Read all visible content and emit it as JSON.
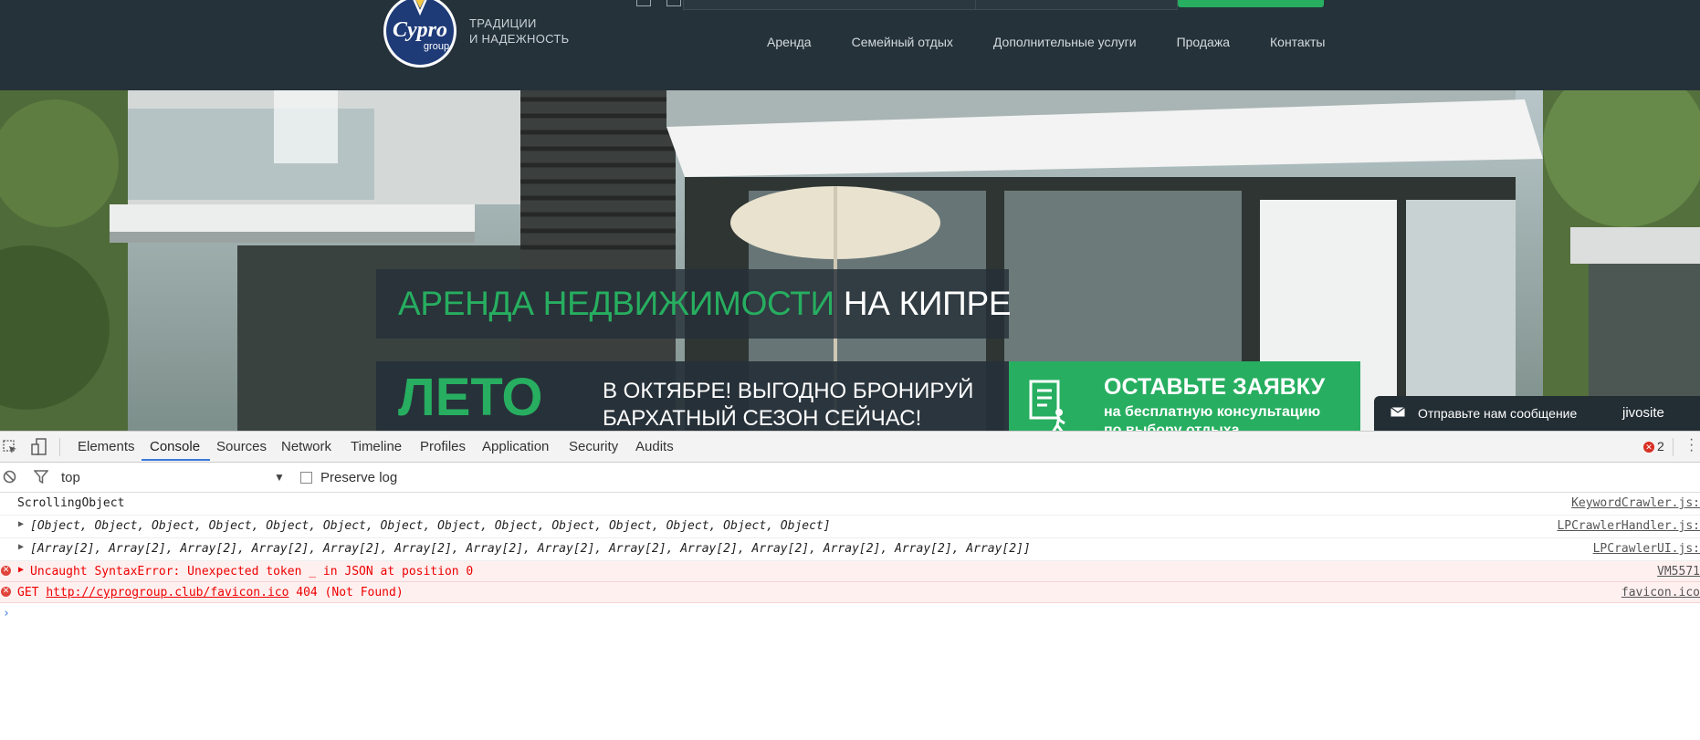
{
  "site": {
    "logo_text": "Cypro",
    "logo_sub": "group",
    "tagline_line1": "ТРАДИЦИИ",
    "tagline_line2": "И НАДЕЖНОСТЬ",
    "nav": [
      "Аренда",
      "Семейный отдых",
      "Дополнительные услуги",
      "Продажа",
      "Контакты"
    ]
  },
  "hero": {
    "title_green": "АРЕНДА НЕДВИЖИМОСТИ",
    "title_white": " НА КИПРЕ",
    "promo_big": "ЛЕТО",
    "promo_line1": "В ОКТЯБРЕ! ВЫГОДНО БРОНИРУЙ",
    "promo_line2": "БАРХАТНЫЙ СЕЗОН СЕЙЧАС!",
    "cta_heading": "ОСТАВЬТЕ ЗАЯВКУ",
    "cta_line1": "на бесплатную консультацию",
    "cta_line2": "по выбору отдыха"
  },
  "chat_widget": {
    "message": "Отправьте нам сообщение",
    "brand": "jivosite"
  },
  "devtools": {
    "tabs": [
      "Elements",
      "Console",
      "Sources",
      "Network",
      "Timeline",
      "Profiles",
      "Application",
      "Security",
      "Audits"
    ],
    "active_tab": "Console",
    "error_count": "2",
    "context": "top",
    "preserve_log": "Preserve log",
    "messages": [
      {
        "text": "ScrollingObject",
        "source": "KeywordCrawler.js:"
      },
      {
        "text": "[Object, Object, Object, Object, Object, Object, Object, Object, Object, Object, Object, Object, Object, Object]",
        "source": "LPCrawlerHandler.js:"
      },
      {
        "text": "[Array[2], Array[2], Array[2], Array[2], Array[2], Array[2], Array[2], Array[2], Array[2], Array[2], Array[2], Array[2], Array[2], Array[2]]",
        "source": "LPCrawlerUI.js:"
      }
    ],
    "errors": [
      {
        "text": "Uncaught SyntaxError: Unexpected token _ in JSON at position 0",
        "source": "VM5571"
      },
      {
        "method": "GET",
        "url": "http://cyprogroup.club/favicon.ico",
        "status": "404 (Not Found)",
        "source": "favicon.ico"
      }
    ],
    "colors": {
      "accent": "#3879d9",
      "error": "#e00000",
      "brand_green": "#27ae60"
    }
  }
}
